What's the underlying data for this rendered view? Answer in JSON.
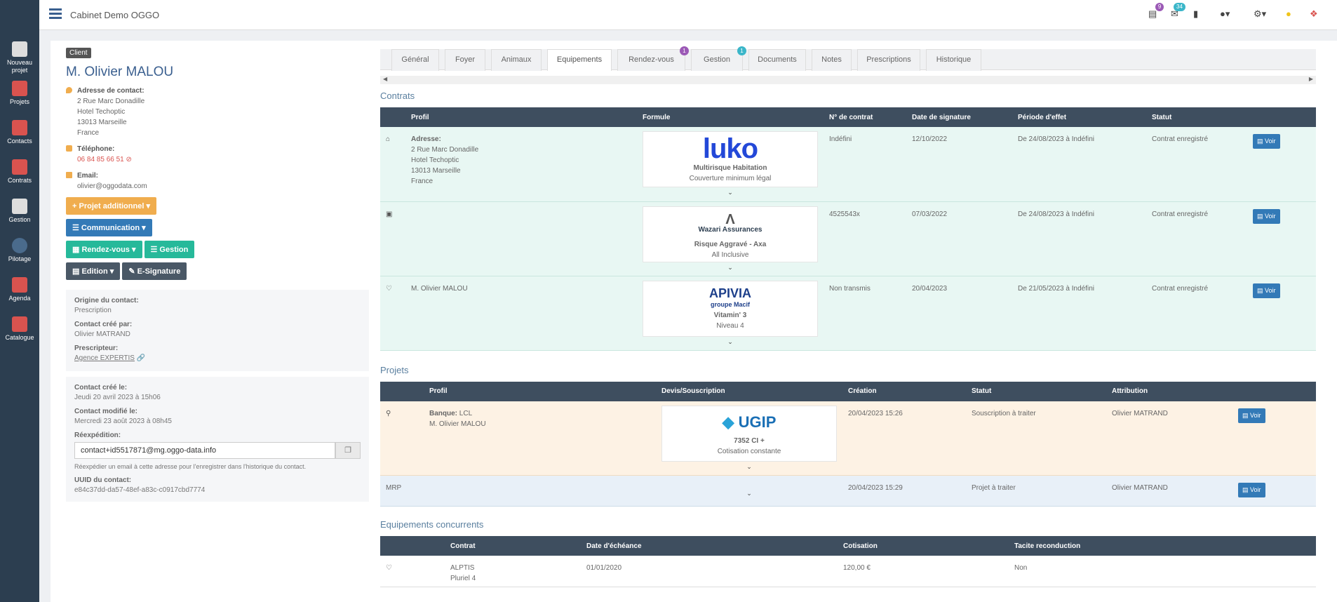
{
  "app": {
    "title": "Cabinet Demo OGGO"
  },
  "topbar": {
    "badge1": "9",
    "badge2": "34"
  },
  "sidebar": {
    "items": [
      {
        "label": "Nouveau projet"
      },
      {
        "label": "Projets"
      },
      {
        "label": "Contacts"
      },
      {
        "label": "Contrats"
      },
      {
        "label": "Gestion"
      },
      {
        "label": "Pilotage"
      },
      {
        "label": "Agenda"
      },
      {
        "label": "Catalogue"
      }
    ]
  },
  "client": {
    "badge": "Client",
    "name": "M. Olivier MALOU",
    "address_label": "Adresse de contact:",
    "address": [
      "2 Rue Marc Donadille",
      "Hotel Techoptic",
      "13013 Marseille",
      "France"
    ],
    "phone_label": "Téléphone:",
    "phone": "06 84 85 66 51",
    "email_label": "Email:",
    "email": "olivier@oggodata.com"
  },
  "actions": {
    "projet": "Projet additionnel",
    "communication": "Communication",
    "rdv": "Rendez-vous",
    "gestion": "Gestion",
    "edition": "Edition",
    "esignature": "E-Signature"
  },
  "origin": {
    "origin_label": "Origine du contact:",
    "origin": "Prescription",
    "created_by_label": "Contact créé par:",
    "created_by": "Olivier MATRAND",
    "prescripteur_label": "Prescripteur:",
    "prescripteur": "Agence EXPERTIS"
  },
  "meta": {
    "created_label": "Contact créé le:",
    "created": "Jeudi 20 avril 2023 à 15h06",
    "modified_label": "Contact modifié le:",
    "modified": "Mercredi 23 août 2023 à 08h45",
    "reexp_label": "Réexpédition:",
    "reexp_value": "contact+id5517871@mg.oggo-data.info",
    "reexp_help": "Réexpédier un email à cette adresse pour l'enregistrer dans l'historique du contact.",
    "uuid_label": "UUID du contact:",
    "uuid": "e84c37dd-da57-48ef-a83c-c0917cbd7774"
  },
  "tabs": [
    {
      "label": "Général"
    },
    {
      "label": "Foyer"
    },
    {
      "label": "Animaux"
    },
    {
      "label": "Equipements"
    },
    {
      "label": "Rendez-vous",
      "badge": "1"
    },
    {
      "label": "Gestion",
      "badge": "1"
    },
    {
      "label": "Documents"
    },
    {
      "label": "Notes"
    },
    {
      "label": "Prescriptions"
    },
    {
      "label": "Historique"
    }
  ],
  "contracts": {
    "title": "Contrats",
    "headers": [
      "Profil",
      "Formule",
      "N° de contrat",
      "Date de signature",
      "Période d'effet",
      "Statut"
    ],
    "rows": [
      {
        "profile_label": "Adresse:",
        "profile": [
          "2 Rue Marc Donadille",
          "Hotel Techoptic",
          "13013 Marseille",
          "France"
        ],
        "logo": "luko",
        "formule": "Multirisque Habitation",
        "sub": "Couverture minimum légal",
        "num": "Indéfini",
        "date": "12/10/2022",
        "period": "De 24/08/2023 à Indéfini",
        "status": "Contrat enregistré",
        "btn": "Voir"
      },
      {
        "profile_label": "",
        "profile": [],
        "logo": "Wazari Assurances",
        "formule": "Risque Aggravé - Axa",
        "sub": "All Inclusive",
        "num": "4525543x",
        "date": "07/03/2022",
        "period": "De 24/08/2023 à Indéfini",
        "status": "Contrat enregistré",
        "btn": "Voir"
      },
      {
        "profile_label": "",
        "profile": [
          "M. Olivier MALOU"
        ],
        "logo": "APIVIA",
        "logo2": "groupe Macif",
        "formule": "Vitamin' 3",
        "sub": "Niveau 4",
        "num": "Non transmis",
        "date": "20/04/2023",
        "period": "De 21/05/2023 à Indéfini",
        "status": "Contrat enregistré",
        "btn": "Voir"
      }
    ]
  },
  "projects": {
    "title": "Projets",
    "headers": [
      "Profil",
      "Devis/Souscription",
      "Création",
      "Statut",
      "Attribution"
    ],
    "rows": [
      {
        "label": "Banque:",
        "bank": "LCL",
        "name": "M. Olivier MALOU",
        "logo": "UGIP",
        "formule": "7352 CI +",
        "sub": "Cotisation constante",
        "created": "20/04/2023 15:26",
        "status": "Souscription à traiter",
        "attr": "Olivier MATRAND",
        "btn": "Voir"
      },
      {
        "name": "MRP",
        "created": "20/04/2023 15:29",
        "status": "Projet à traiter",
        "attr": "Olivier MATRAND",
        "btn": "Voir"
      }
    ]
  },
  "competitors": {
    "title": "Equipements concurrents",
    "headers": [
      "Contrat",
      "Date d'échéance",
      "Cotisation",
      "Tacite reconduction"
    ],
    "rows": [
      {
        "contract": "ALPTIS",
        "sub": "Pluriel 4",
        "date": "01/01/2020",
        "amount": "120,00 €",
        "tacite": "Non"
      }
    ]
  }
}
